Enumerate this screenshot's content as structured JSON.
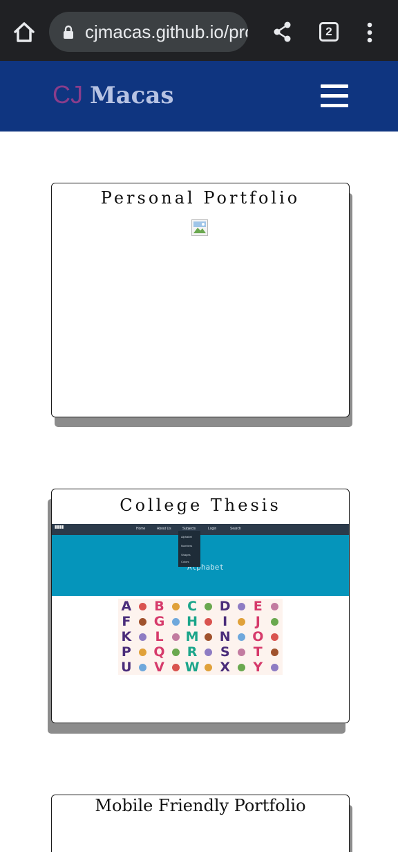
{
  "browser": {
    "url": "cjmacas.github.io/pro",
    "tab_count": "2",
    "icons": [
      "home-icon",
      "lock-icon",
      "share-icon",
      "tab-switcher-icon",
      "more-vert-icon"
    ]
  },
  "site": {
    "brand_cj": "CJ",
    "brand_name": "Macas",
    "colors": {
      "header_bg": "#0f3580",
      "brand_cj": "#8a3d8b",
      "brand_name": "#b7c3e3"
    }
  },
  "projects": [
    {
      "title": "Personal Portfolio"
    },
    {
      "title": "College Thesis",
      "preview": {
        "nav_items": [
          "Home",
          "About Us",
          "Subjects",
          "Login",
          "Search"
        ],
        "dropdown_items": [
          "Alphabet",
          "Numbers",
          "Shapes",
          "Colors"
        ],
        "banner_word": "Alphabet",
        "alphabet": [
          "A",
          "B",
          "C",
          "D",
          "E",
          "F",
          "G",
          "H",
          "I",
          "J",
          "K",
          "L",
          "M",
          "N",
          "O",
          "P",
          "Q",
          "R",
          "S",
          "T",
          "U",
          "V",
          "W",
          "X",
          "Y"
        ]
      }
    },
    {
      "title": "Mobile Friendly Portfolio"
    }
  ]
}
